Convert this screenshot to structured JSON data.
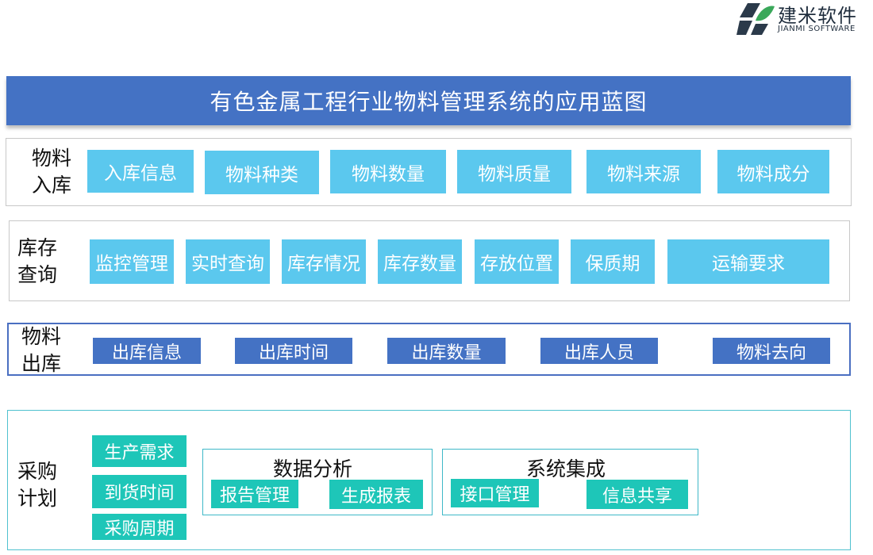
{
  "logo": {
    "name": "建米软件",
    "english": "JIANMI SOFTWARE"
  },
  "title": "有色金属工程行业物料管理系统的应用蓝图",
  "sections": {
    "inbound": {
      "label_line1": "物料",
      "label_line2": "入库",
      "items": [
        "入库信息",
        "物料种类",
        "物料数量",
        "物料质量",
        "物料来源",
        "物料成分"
      ]
    },
    "inventory": {
      "label_line1": "库存",
      "label_line2": "查询",
      "items": [
        "监控管理",
        "实时查询",
        "库存情况",
        "库存数量",
        "存放位置",
        "保质期",
        "运输要求"
      ]
    },
    "outbound": {
      "label_line1": "物料",
      "label_line2": "出库",
      "items": [
        "出库信息",
        "出库时间",
        "出库数量",
        "出库人员",
        "物料去向"
      ]
    },
    "purchase": {
      "label_line1": "采购",
      "label_line2": "计划",
      "items": [
        "生产需求",
        "到货时间",
        "采购周期"
      ],
      "data_analysis": {
        "title": "数据分析",
        "items": [
          "报告管理",
          "生成报表"
        ]
      },
      "system_integration": {
        "title": "系统集成",
        "items": [
          "接口管理",
          "信息共享"
        ]
      }
    }
  },
  "colors": {
    "title_bar": "#4472c4",
    "cyan_box": "#5bc8ee",
    "navy_box": "#4472c4",
    "teal_box": "#1ec6b8",
    "teal_frame": "#4fc1cf"
  }
}
